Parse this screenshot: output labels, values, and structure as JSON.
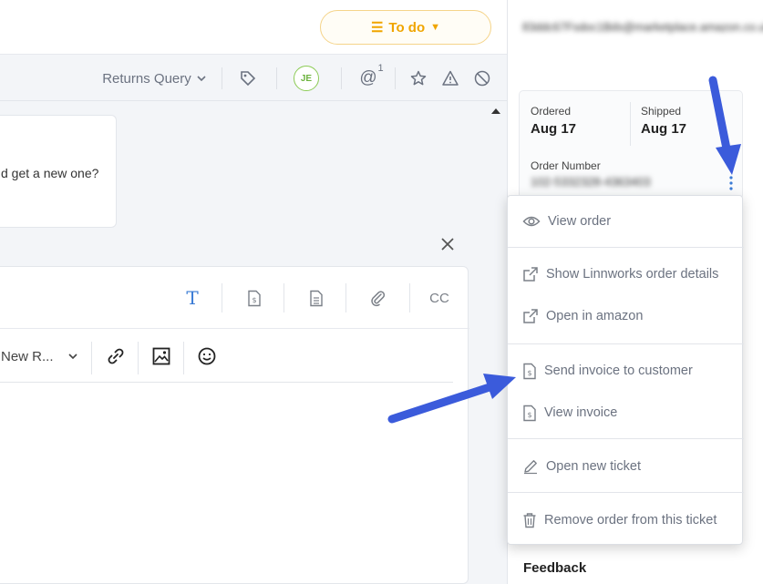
{
  "header": {
    "status_label": "To do",
    "status_color": "#f0a500"
  },
  "toolbar": {
    "category_label": "Returns Query",
    "assignee_initials": "JE",
    "mention_count": "1"
  },
  "conversation": {
    "message_fragment": "d get a new one?"
  },
  "composer": {
    "cc_label": "CC",
    "format_label": "New R..."
  },
  "customer": {
    "email": "83ddc67Fsdoc1Bds@marketplace.amazon.co.uk"
  },
  "order": {
    "ordered_label": "Ordered",
    "ordered_value": "Aug 17",
    "shipped_label": "Shipped",
    "shipped_value": "Aug 17",
    "number_label": "Order Number",
    "number_value": "102-5332328-4363403"
  },
  "menu": {
    "items": [
      {
        "label": "View order",
        "icon": "eye-icon"
      },
      {
        "label": "Show Linnworks order details",
        "icon": "external-link-icon"
      },
      {
        "label": "Open in amazon",
        "icon": "external-link-icon"
      },
      {
        "label": "Send invoice to customer",
        "icon": "invoice-icon"
      },
      {
        "label": "View invoice",
        "icon": "invoice-icon"
      },
      {
        "label": "Open new ticket",
        "icon": "pencil-icon"
      },
      {
        "label": "Remove order from this ticket",
        "icon": "trash-icon"
      }
    ]
  },
  "sidebar": {
    "feedback_label": "Feedback"
  },
  "colors": {
    "accent": "#3a7bd5",
    "annotation_arrow": "#3b5bdb"
  }
}
